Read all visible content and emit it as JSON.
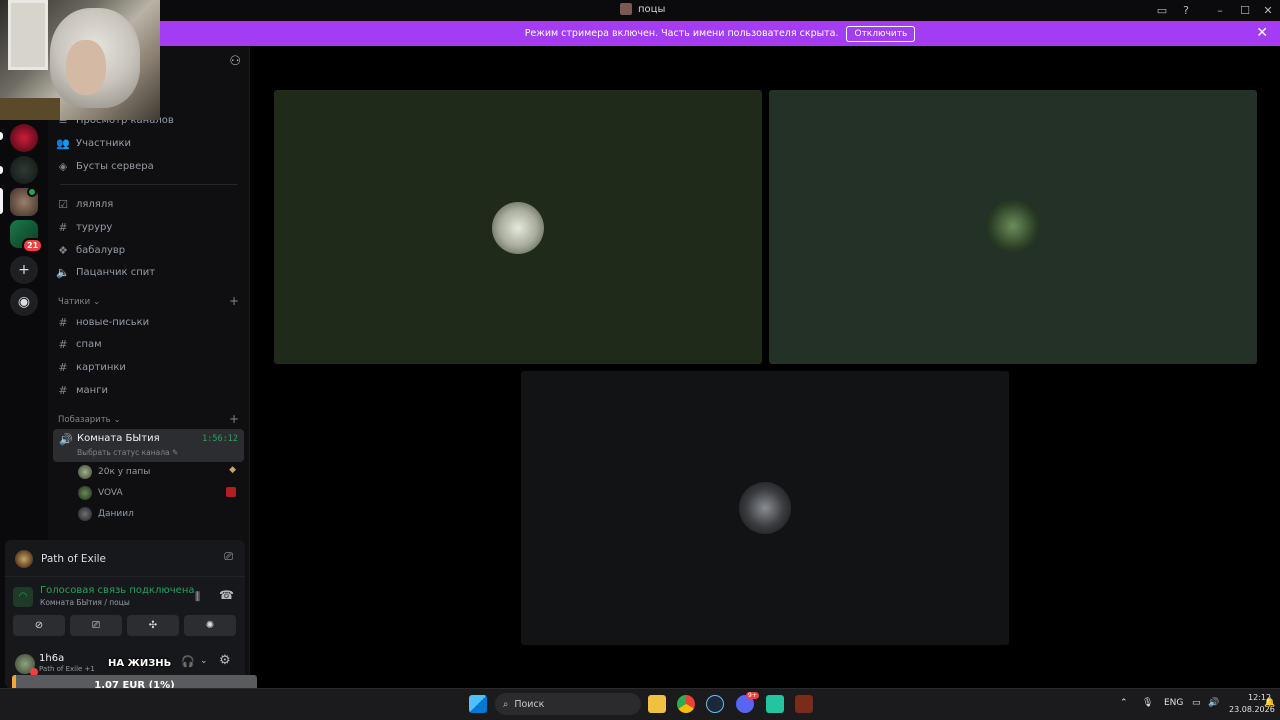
{
  "window": {
    "title": "поцы"
  },
  "banner": {
    "text": "Режим стримера включен. Часть имени пользователя скрыта.",
    "button": "Отключить"
  },
  "sidebar": {
    "items": [
      {
        "label": "Просмотр каналов",
        "icon": "browse-icon"
      },
      {
        "label": "Участники",
        "icon": "members-icon"
      },
      {
        "label": "Бусты сервера",
        "icon": "boost-icon"
      }
    ],
    "channels_top": [
      {
        "label": "ляляля",
        "icon": "rules-icon"
      },
      {
        "label": "туруру",
        "icon": "hash-icon"
      },
      {
        "label": "бабалувр",
        "icon": "forum-icon"
      },
      {
        "label": "Пацанчик спит",
        "icon": "voice-icon"
      }
    ],
    "category_chat": "Чатики",
    "channels_chat": [
      {
        "label": "новые-письки"
      },
      {
        "label": "спам"
      },
      {
        "label": "картинки"
      },
      {
        "label": "манги"
      }
    ],
    "category_voice": "Побазарить",
    "active_voice": {
      "name": "Комната БЫтия",
      "timer": "1:56:12",
      "status": "Выбрать статус канала"
    },
    "voice_users": [
      {
        "name": "20к у папы"
      },
      {
        "name": "VOVA"
      },
      {
        "name": "Даниил"
      }
    ]
  },
  "rail": {
    "badge_count": "21"
  },
  "panel": {
    "game": "Path of Exile",
    "connection": "Голосовая связь подключена",
    "connection_sub": "Комната БЫтия / поцы",
    "username": "1h6a",
    "user_status": "Path of Exile +1"
  },
  "donation": {
    "label": "НА ЖИЗНЬ",
    "amount": "1.07 EUR (1%)",
    "progress": 0.01,
    "min": "0",
    "max": "100",
    "color": "#f2a63a"
  },
  "taskbar": {
    "search_placeholder": "Поиск",
    "lang": "ENG",
    "time": "12:12",
    "date": "23.08.2026",
    "discord_badge": "9+"
  },
  "colors": {
    "accent": "#a23df4",
    "connected": "#23a55a",
    "alert": "#f23f43"
  }
}
